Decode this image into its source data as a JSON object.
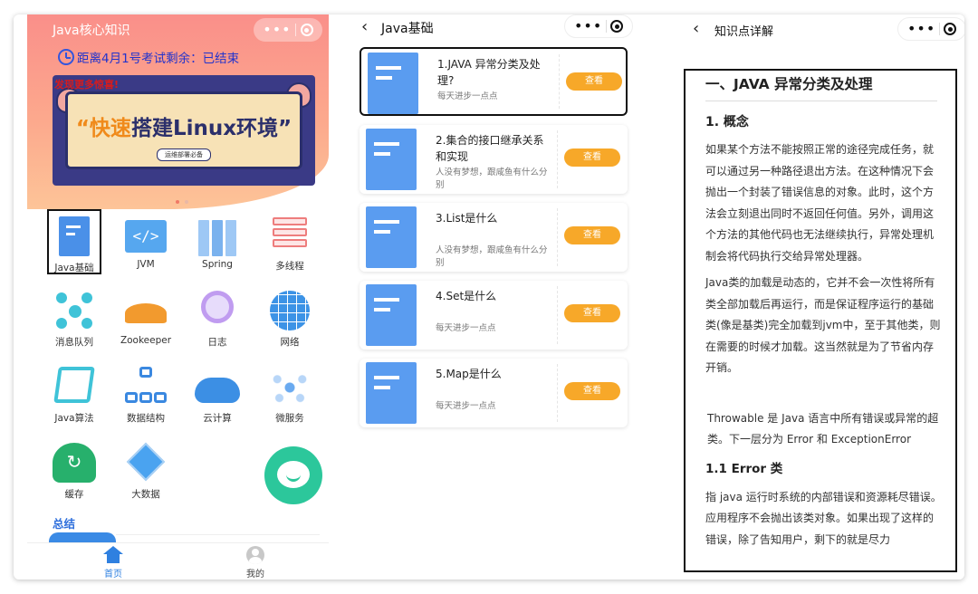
{
  "colors": {
    "accent_blue": "#2f80e0",
    "orange_button": "#f7a829",
    "hero_gradient_top": "#fa8f8a",
    "fab_green": "#2cc79b"
  },
  "screen1": {
    "nav_title": "Java核心知识",
    "countdown": "距离4月1号考试剩余：已结束",
    "banner": {
      "tag": "发现更多惊喜!",
      "main_a": "“快速",
      "main_b": "搭建Linux环境”",
      "sub": "运维部署必备"
    },
    "categories": [
      {
        "label": "Java基础",
        "icon": "document-icon"
      },
      {
        "label": "JVM",
        "icon": "code-window-icon"
      },
      {
        "label": "Spring",
        "icon": "books-icon"
      },
      {
        "label": "多线程",
        "icon": "layers-icon"
      },
      {
        "label": "消息队列",
        "icon": "network-nodes-icon"
      },
      {
        "label": "Zookeeper",
        "icon": "zookeeper-icon"
      },
      {
        "label": "日志",
        "icon": "search-icon"
      },
      {
        "label": "网络",
        "icon": "globe-icon"
      },
      {
        "label": "Java算法",
        "icon": "algorithm-icon"
      },
      {
        "label": "数据结构",
        "icon": "tree-structure-icon"
      },
      {
        "label": "云计算",
        "icon": "cloud-icon"
      },
      {
        "label": "微服务",
        "icon": "microservice-icon"
      },
      {
        "label": "缓存",
        "icon": "cache-icon"
      },
      {
        "label": "大数据",
        "icon": "cube-icon"
      }
    ],
    "summary_title": "总结",
    "tabs": {
      "home": "首页",
      "me": "我的"
    }
  },
  "screen2": {
    "title": "Java基础",
    "back_icon": "chevron-left-icon",
    "view_label": "查看",
    "items": [
      {
        "title": "1.JAVA 异常分类及处理?",
        "sub": "每天进步一点点"
      },
      {
        "title": "2.集合的接口继承关系和实现",
        "sub": "人没有梦想，跟咸鱼有什么分别"
      },
      {
        "title": "3.List是什么",
        "sub": "人没有梦想，跟咸鱼有什么分别"
      },
      {
        "title": "4.Set是什么",
        "sub": "每天进步一点点"
      },
      {
        "title": "5.Map是什么",
        "sub": "每天进步一点点"
      }
    ]
  },
  "screen3": {
    "title": "知识点详解",
    "h1": "一、JAVA 异常分类及处理",
    "h2": "1. 概念",
    "p1": "如果某个方法不能按照正常的途径完成任务，就可以通过另一种路径退出方法。在这种情况下会抛出一个封装了错误信息的对象。此时，这个方法会立刻退出同时不返回任何值。另外，调用这个方法的其他代码也无法继续执行，异常处理机制会将代码执行交给异常处理器。",
    "p2": "Java类的加载是动态的，它并不会一次性将所有类全部加载后再运行，而是保证程序运行的基础类(像是基类)完全加载到jvm中，至于其他类，则在需要的时候才加载。这当然就是为了节省内存开销。",
    "p3": "Throwable 是 Java 语言中所有错误或异常的超类。下一层分为 Error 和 ExceptionError",
    "h3": "1.1 Error 类",
    "p4": "指 java 运行时系统的内部错误和资源耗尽错误。应用程序不会抛出该类对象。如果出现了这样的错误，除了告知用户，剩下的就是尽力"
  }
}
